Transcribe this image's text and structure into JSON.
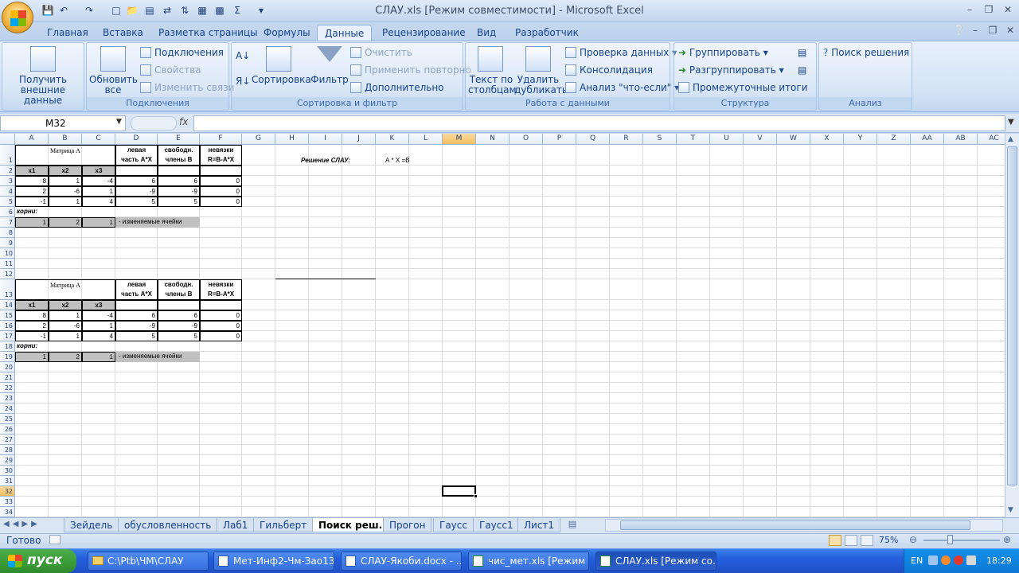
{
  "window": {
    "title": "СЛАУ.xls  [Режим совместимости] - Microsoft Excel"
  },
  "ribbon": {
    "tabs": [
      "Главная",
      "Вставка",
      "Разметка страницы",
      "Формулы",
      "Данные",
      "Рецензирование",
      "Вид",
      "Разработчик"
    ],
    "active_tab": "Данные",
    "groups": {
      "external": {
        "button": "Получить внешние данные"
      },
      "connections": {
        "label": "Подключения",
        "refresh": "Обновить все",
        "items": [
          "Подключения",
          "Свойства",
          "Изменить связи"
        ]
      },
      "sort": {
        "label": "Сортировка и фильтр",
        "sort": "Сортировка",
        "filter": "Фильтр",
        "items": [
          "Очистить",
          "Применить повторно",
          "Дополнительно"
        ]
      },
      "data_tools": {
        "label": "Работа с данными",
        "text_to_cols": "Текст по столбцам",
        "remove_dup": "Удалить дубликаты",
        "items": [
          "Проверка данных",
          "Консолидация",
          "Анализ \"что-если\""
        ]
      },
      "outline": {
        "label": "Структура",
        "items": [
          "Группировать",
          "Разгруппировать",
          "Промежуточные итоги"
        ]
      },
      "analysis": {
        "label": "Анализ",
        "solver": "Поиск решения"
      }
    }
  },
  "formula_bar": {
    "name_box": "M32",
    "fx": "fx",
    "value": ""
  },
  "columns": [
    "A",
    "B",
    "C",
    "D",
    "E",
    "F",
    "G",
    "H",
    "I",
    "J",
    "K",
    "L",
    "M",
    "N",
    "O",
    "P",
    "Q",
    "R",
    "S",
    "T",
    "U",
    "V",
    "W",
    "X",
    "Y",
    "Z",
    "AA",
    "AB",
    "AC"
  ],
  "selected_col": "M",
  "selected_row": "32",
  "rows": [
    "1",
    "2",
    "3",
    "4",
    "5",
    "6",
    "7",
    "8",
    "9",
    "10",
    "11",
    "12",
    "13",
    "14",
    "15",
    "16",
    "17",
    "18",
    "19",
    "20",
    "21",
    "22",
    "23",
    "24",
    "25",
    "26",
    "27",
    "28",
    "29",
    "30",
    "31",
    "32",
    "33",
    "34"
  ],
  "sheet": {
    "matrix_title": "Матрица А",
    "hdr_left": [
      "левая",
      "часть А*Х"
    ],
    "hdr_free": [
      "свободн.",
      "члены В"
    ],
    "hdr_resid": [
      "невязки",
      "R=B-A*X"
    ],
    "vars": [
      "x1",
      "x2",
      "x3"
    ],
    "matrix": [
      [
        "8",
        "1",
        "-4",
        "6",
        "6",
        "0"
      ],
      [
        "2",
        "-6",
        "1",
        "-9",
        "-9",
        "0"
      ],
      [
        "-1",
        "1",
        "4",
        "5",
        "5",
        "0"
      ]
    ],
    "roots_label": "корни:",
    "roots": [
      "1",
      "2",
      "1"
    ],
    "changing_note": "- изменяемые ячейки",
    "solve_label": "Решение СЛАУ:",
    "equation": "А * X =B"
  },
  "sheet_tabs": [
    "Зейдель",
    "обусловленность",
    "Лаб1",
    "Гильберт",
    "Поиск реш.",
    "Прогон",
    "Гаусс",
    "Гаусс1",
    "Лист1"
  ],
  "active_sheet": "Поиск реш.",
  "status": {
    "ready": "Готово",
    "zoom": "75%"
  },
  "taskbar": {
    "start": "пуск",
    "tasks": [
      "C:\\Ptb\\ЧМ\\СЛАУ",
      "Мет-Инф2-Чм-Зао13...",
      "СЛАУ-Якоби.docx - ...",
      "чис_мет.xls  [Режим ...",
      "СЛАУ.xls  [Режим со..."
    ],
    "lang": "EN",
    "clock": "18:29"
  },
  "colors": {
    "accent": "#15428b",
    "selection": "#f1c05f",
    "taskbar": "#245edb"
  }
}
